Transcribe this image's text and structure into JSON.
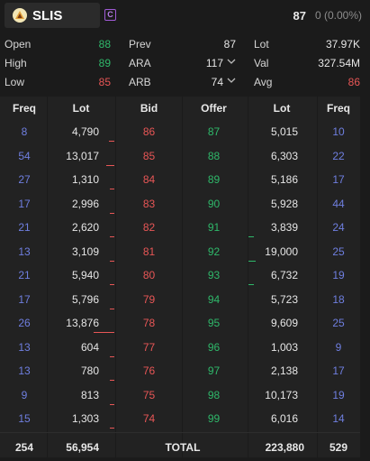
{
  "header": {
    "ticker": "SLIS",
    "badge": "C",
    "price": "87",
    "change": "0 (0.00%)"
  },
  "stats": {
    "open_label": "Open",
    "open_value": "88",
    "high_label": "High",
    "high_value": "89",
    "low_label": "Low",
    "low_value": "85",
    "prev_label": "Prev",
    "prev_value": "87",
    "ara_label": "ARA",
    "ara_value": "117",
    "arb_label": "ARB",
    "arb_value": "74",
    "lot_label": "Lot",
    "lot_value": "37.97K",
    "val_label": "Val",
    "val_value": "327.54M",
    "avg_label": "Avg",
    "avg_value": "86"
  },
  "orderbook": {
    "headers": {
      "freq_left": "Freq",
      "lot_left": "Lot",
      "bid": "Bid",
      "offer": "Offer",
      "lot_right": "Lot",
      "freq_right": "Freq"
    },
    "rows": [
      {
        "bid_freq": "8",
        "bid_lot": "4,790",
        "bid": "86",
        "offer": "87",
        "offer_lot": "5,015",
        "offer_freq": "10"
      },
      {
        "bid_freq": "54",
        "bid_lot": "13,017",
        "bid": "85",
        "offer": "88",
        "offer_lot": "6,303",
        "offer_freq": "22"
      },
      {
        "bid_freq": "27",
        "bid_lot": "1,310",
        "bid": "84",
        "offer": "89",
        "offer_lot": "5,186",
        "offer_freq": "17"
      },
      {
        "bid_freq": "17",
        "bid_lot": "2,996",
        "bid": "83",
        "offer": "90",
        "offer_lot": "5,928",
        "offer_freq": "44"
      },
      {
        "bid_freq": "21",
        "bid_lot": "2,620",
        "bid": "82",
        "offer": "91",
        "offer_lot": "3,839",
        "offer_freq": "24"
      },
      {
        "bid_freq": "13",
        "bid_lot": "3,109",
        "bid": "81",
        "offer": "92",
        "offer_lot": "19,000",
        "offer_freq": "25"
      },
      {
        "bid_freq": "21",
        "bid_lot": "5,940",
        "bid": "80",
        "offer": "93",
        "offer_lot": "6,732",
        "offer_freq": "19"
      },
      {
        "bid_freq": "17",
        "bid_lot": "5,796",
        "bid": "79",
        "offer": "94",
        "offer_lot": "5,723",
        "offer_freq": "18"
      },
      {
        "bid_freq": "26",
        "bid_lot": "13,876",
        "bid": "78",
        "offer": "95",
        "offer_lot": "9,609",
        "offer_freq": "25"
      },
      {
        "bid_freq": "13",
        "bid_lot": "604",
        "bid": "77",
        "offer": "96",
        "offer_lot": "1,003",
        "offer_freq": "9"
      },
      {
        "bid_freq": "13",
        "bid_lot": "780",
        "bid": "76",
        "offer": "97",
        "offer_lot": "2,138",
        "offer_freq": "17"
      },
      {
        "bid_freq": "9",
        "bid_lot": "813",
        "bid": "75",
        "offer": "98",
        "offer_lot": "10,173",
        "offer_freq": "19"
      },
      {
        "bid_freq": "15",
        "bid_lot": "1,303",
        "bid": "74",
        "offer": "99",
        "offer_lot": "6,016",
        "offer_freq": "14"
      }
    ],
    "total": {
      "bid_freq": "254",
      "bid_lot": "56,954",
      "label": "TOTAL",
      "offer_lot": "223,880",
      "offer_freq": "529"
    }
  },
  "colors": {
    "up": "#2fb86a",
    "down": "#e85656",
    "freq": "#6f7fe0",
    "badge": "#a05bd6"
  },
  "icons": {
    "logo": "slis-logo-icon",
    "chevron": "chevron-down-icon"
  }
}
